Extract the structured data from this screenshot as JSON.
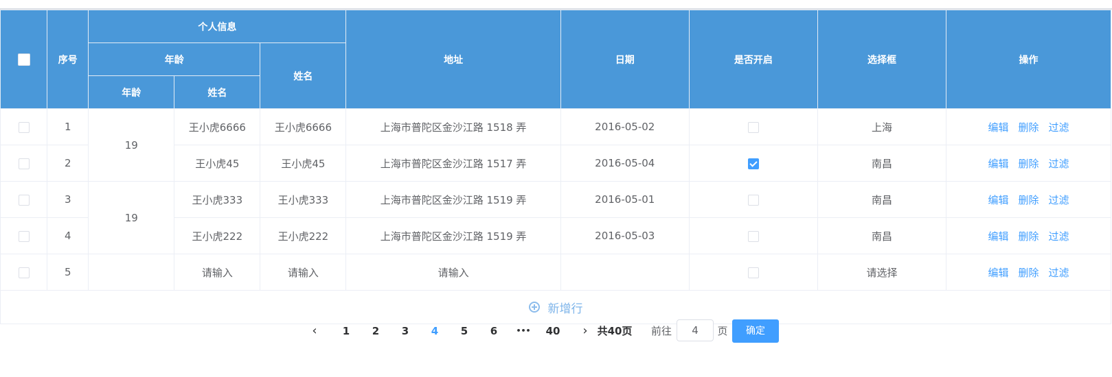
{
  "header": {
    "index": "序号",
    "personal_info": "个人信息",
    "age_group": "年龄",
    "name_col": "姓名",
    "age_sub": "年龄",
    "name_sub": "姓名",
    "address": "地址",
    "date": "日期",
    "enabled": "是否开启",
    "select": "选择框",
    "actions": "操作"
  },
  "rows": [
    {
      "index": "1",
      "age": "19",
      "name1": "王小虎6666",
      "name2": "王小虎6666",
      "address": "上海市普陀区金沙江路 1518 弄",
      "date": "2016-05-02",
      "checked": false,
      "select": "上海"
    },
    {
      "index": "2",
      "age": "19",
      "name1": "王小虎45",
      "name2": "王小虎45",
      "address": "上海市普陀区金沙江路 1517 弄",
      "date": "2016-05-04",
      "checked": true,
      "select": "南昌"
    },
    {
      "index": "3",
      "age": "19",
      "name1": "王小虎333",
      "name2": "王小虎333",
      "address": "上海市普陀区金沙江路 1519 弄",
      "date": "2016-05-01",
      "checked": false,
      "select": "南昌"
    },
    {
      "index": "4",
      "age": "19",
      "name1": "王小虎222",
      "name2": "王小虎222",
      "address": "上海市普陀区金沙江路 1519 弄",
      "date": "2016-05-03",
      "checked": false,
      "select": "南昌"
    },
    {
      "index": "5",
      "name1_placeholder": "请输入",
      "name2_placeholder": "请输入",
      "address_placeholder": "请输入",
      "checked": false,
      "select_placeholder": "请选择"
    }
  ],
  "row_actions": {
    "edit": "编辑",
    "delete": "删除",
    "filter": "过滤"
  },
  "add_row": "新增行",
  "pagination": {
    "prev": "‹",
    "next": "›",
    "pages": [
      "1",
      "2",
      "3",
      "4",
      "5",
      "6"
    ],
    "current": "4",
    "ellipsis": "•••",
    "last_page": "40",
    "total": "共40页",
    "goto_prefix": "前往",
    "goto_value": "4",
    "goto_suffix": "页",
    "confirm": "确定"
  },
  "colors": {
    "header_bg": "#4a98d9",
    "accent": "#409eff",
    "index_red": "#f56c6c"
  }
}
